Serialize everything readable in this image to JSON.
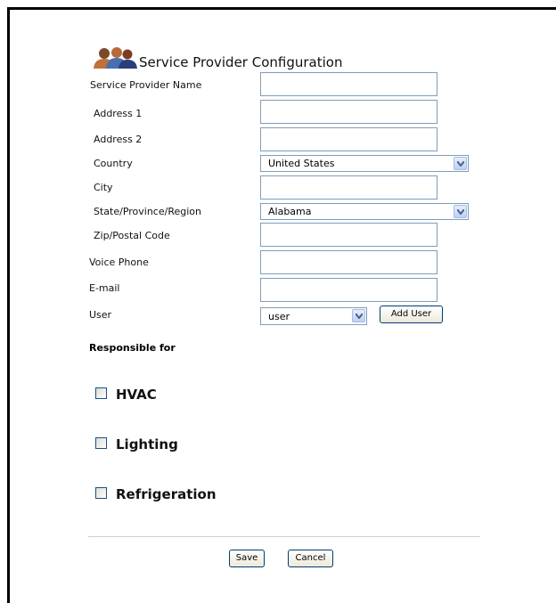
{
  "page": {
    "title": "Service Provider Configuration",
    "icon": "people-group-icon"
  },
  "form": {
    "provider_name_label": "Service Provider Name",
    "provider_name_value": "",
    "address1_label": "Address 1",
    "address1_value": "",
    "address2_label": "Address 2",
    "address2_value": "",
    "country_label": "Country",
    "country_value": "United States",
    "city_label": "City",
    "city_value": "",
    "state_label": "State/Province/Region",
    "state_value": "Alabama",
    "zip_label": "Zip/Postal Code",
    "zip_value": "",
    "phone_label": "Voice Phone",
    "phone_value": "",
    "email_label": "E-mail",
    "email_value": "",
    "user_label": "User",
    "user_value": "user",
    "add_user_label": "Add User"
  },
  "responsible": {
    "heading": "Responsible for",
    "items": [
      {
        "label": "HVAC",
        "checked": false
      },
      {
        "label": "Lighting",
        "checked": false
      },
      {
        "label": "Refrigeration",
        "checked": false
      }
    ]
  },
  "actions": {
    "save_label": "Save",
    "cancel_label": "Cancel"
  },
  "colors": {
    "input_border": "#7f9db9",
    "button_border": "#003c74"
  }
}
